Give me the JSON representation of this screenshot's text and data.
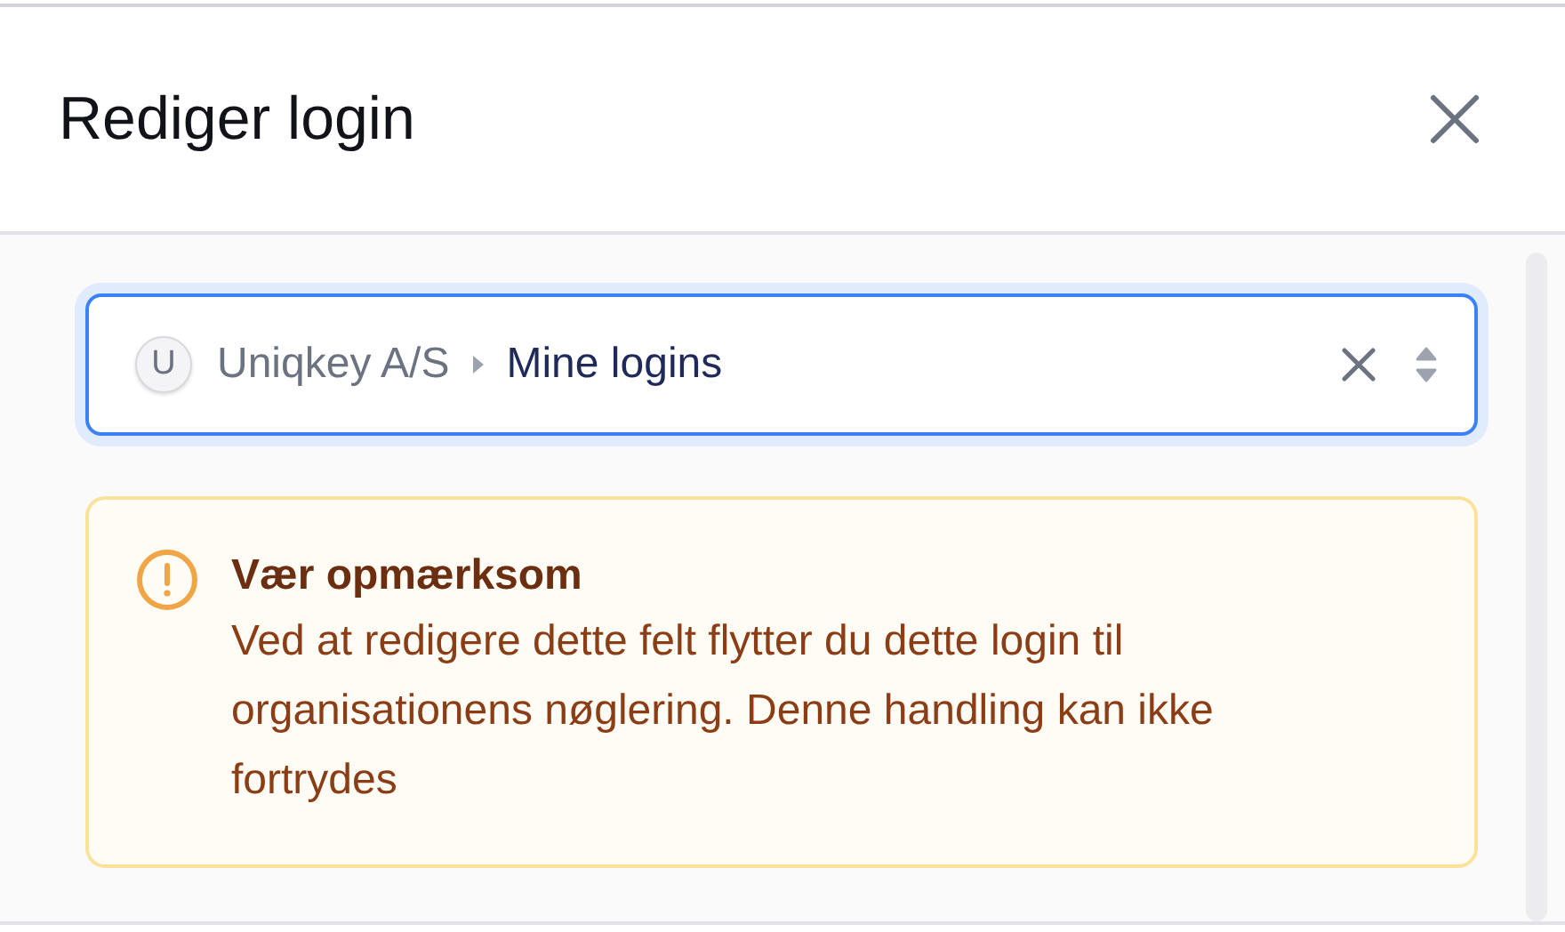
{
  "dialog": {
    "title": "Rediger login"
  },
  "select": {
    "avatar": "U",
    "path": [
      {
        "label": "Uniqkey A/S",
        "current": false
      },
      {
        "label": "Mine logins",
        "current": true
      }
    ],
    "focused": true
  },
  "alert": {
    "kind": "warning",
    "title": "Vær opmærksom",
    "message": "Ved at redigere dette felt flytter du dette login til organisationens nøglering. Denne handling kan ikke fortrydes"
  }
}
